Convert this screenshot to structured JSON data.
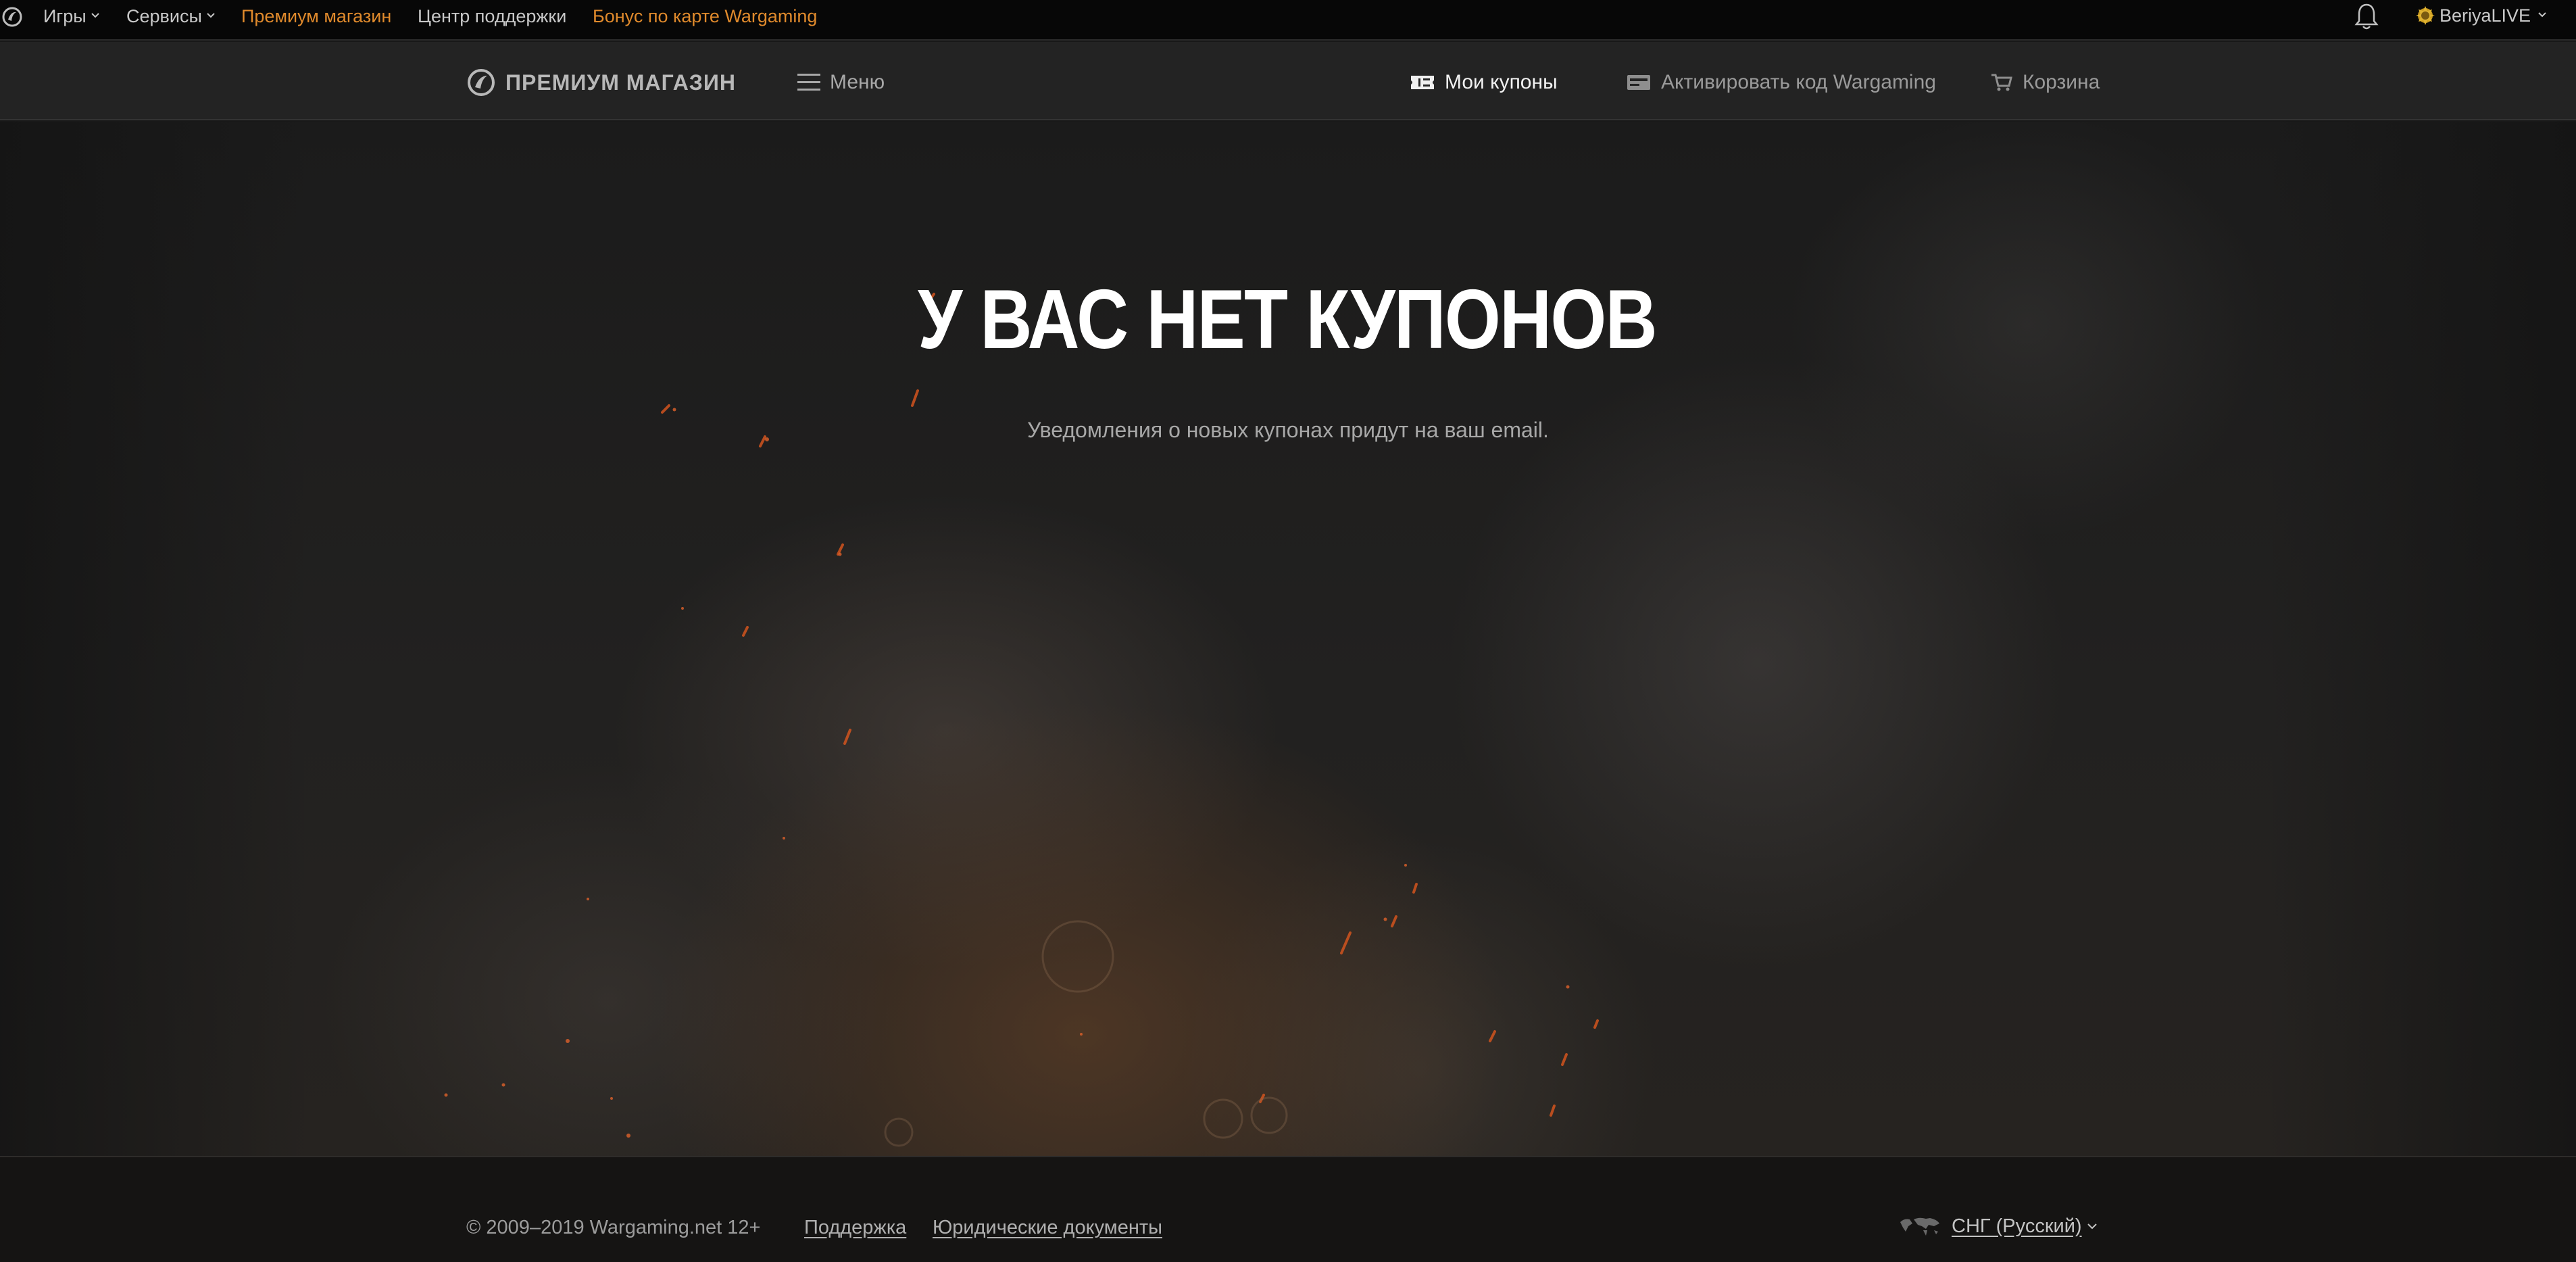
{
  "topbar": {
    "games": "Игры",
    "services": "Сервисы",
    "premium_shop": "Премиум магазин",
    "support_center": "Центр поддержки",
    "card_bonus": "Бонус по карте Wargaming",
    "username": "BeriyaLIVE",
    "accent_color": "#e08a2c"
  },
  "header": {
    "brand": "ПРЕМИУМ МАГАЗИН",
    "menu": "Меню",
    "nav": [
      {
        "label": "Мои купоны",
        "icon": "coupon-icon",
        "active": true
      },
      {
        "label": "Активировать код Wargaming",
        "icon": "code-card-icon",
        "active": false
      },
      {
        "label": "Корзина",
        "icon": "cart-icon",
        "active": false
      }
    ]
  },
  "main": {
    "title": "У ВАС НЕТ КУПОНОВ",
    "subtitle": "Уведомления о новых купонах придут на ваш email."
  },
  "footer": {
    "copyright": "© 2009–2019 Wargaming.net 12+",
    "links": [
      "Поддержка",
      "Юридические документы"
    ],
    "region": "СНГ (Русский)"
  }
}
